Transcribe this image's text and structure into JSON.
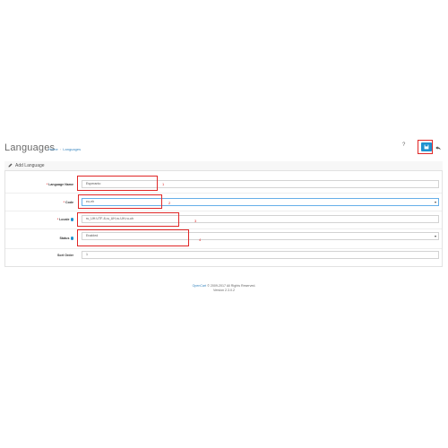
{
  "header": {
    "title": "Languages",
    "breadcrumb": [
      "Home",
      "Languages"
    ],
    "help_glyph": "?"
  },
  "panel": {
    "heading": "Add Language"
  },
  "form": {
    "language_name": {
      "label": "Language Name",
      "value": "Esperanto",
      "marker": "1"
    },
    "code": {
      "label": "Code",
      "value": "eo-eh",
      "marker": "2"
    },
    "locale": {
      "label": "Locale",
      "value": "ru_UH.UTF-8,ru_UH,ru-UH,ru-uh",
      "marker": "3"
    },
    "status": {
      "label": "Status",
      "value": "Enabled",
      "marker": "4"
    },
    "sort_order": {
      "label": "Sort Order",
      "value": "1"
    }
  },
  "footer": {
    "brand": "OpenCart",
    "copyright": "© 2009-2017 All Rights Reserved.",
    "version": "Version 2.3.0.2"
  },
  "colors": {
    "accent": "#1e91cf",
    "highlight": "#e02626",
    "required": "#e02626"
  },
  "icons": {
    "save": "save-icon",
    "back": "reply-icon",
    "heading": "pencil-icon",
    "info": "info-icon"
  }
}
